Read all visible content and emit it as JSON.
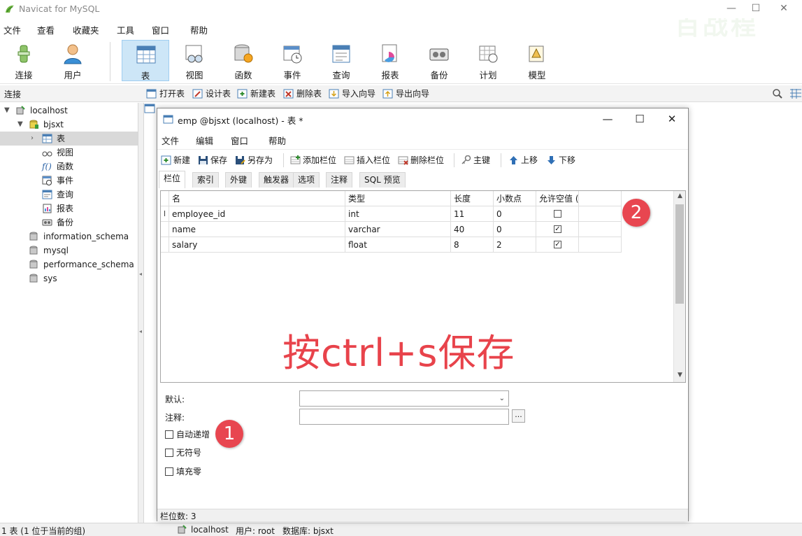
{
  "app": {
    "title": "Navicat for MySQL",
    "menu": [
      "文件",
      "查看",
      "收藏夹",
      "工具",
      "窗口",
      "帮助"
    ],
    "window_controls": {
      "minimize": "—",
      "maximize": "☐",
      "close": "✕"
    }
  },
  "toolbar": {
    "items": [
      {
        "label": "连接",
        "icon": "connect-icon"
      },
      {
        "label": "用户",
        "icon": "user-icon"
      },
      {
        "label": "表",
        "icon": "table-icon",
        "active": true
      },
      {
        "label": "视图",
        "icon": "view-icon"
      },
      {
        "label": "函数",
        "icon": "function-icon"
      },
      {
        "label": "事件",
        "icon": "event-icon"
      },
      {
        "label": "查询",
        "icon": "query-icon"
      },
      {
        "label": "报表",
        "icon": "report-icon"
      },
      {
        "label": "备份",
        "icon": "backup-icon"
      },
      {
        "label": "计划",
        "icon": "schedule-icon"
      },
      {
        "label": "模型",
        "icon": "model-icon"
      }
    ]
  },
  "subbar": {
    "connection_label": "连接",
    "actions": [
      "打开表",
      "设计表",
      "新建表",
      "删除表",
      "导入向导",
      "导出向导"
    ]
  },
  "tree": {
    "items": [
      {
        "label": "localhost",
        "icon": "server-icon",
        "expanded": true
      },
      {
        "label": "bjsxt",
        "icon": "database-icon",
        "expanded": true
      },
      {
        "label": "表",
        "icon": "table-icon",
        "selected": true
      },
      {
        "label": "视图",
        "icon": "view-icon"
      },
      {
        "label": "函数",
        "icon": "function-icon"
      },
      {
        "label": "事件",
        "icon": "event-icon"
      },
      {
        "label": "查询",
        "icon": "query-icon"
      },
      {
        "label": "报表",
        "icon": "report-icon"
      },
      {
        "label": "备份",
        "icon": "backup-icon"
      },
      {
        "label": "information_schema",
        "icon": "database-icon"
      },
      {
        "label": "mysql",
        "icon": "database-icon"
      },
      {
        "label": "performance_schema",
        "icon": "database-icon"
      },
      {
        "label": "sys",
        "icon": "database-icon"
      }
    ]
  },
  "status": {
    "left": "1 表 (1 位于当前的组)",
    "connection": "localhost",
    "user": "用户: root",
    "database": "数据库: bjsxt"
  },
  "designer": {
    "title": "emp @bjsxt (localhost) - 表 *",
    "menu": [
      "文件",
      "编辑",
      "窗口",
      "帮助"
    ],
    "tools": [
      "新建",
      "保存",
      "另存为",
      "添加栏位",
      "插入栏位",
      "删除栏位",
      "主键",
      "上移",
      "下移"
    ],
    "tabs": [
      "栏位",
      "索引",
      "外键",
      "触发器",
      "选项",
      "注释",
      "SQL 预览"
    ],
    "columns": [
      "名",
      "类型",
      "长度",
      "小数点",
      "允许空值 ("
    ],
    "rows": [
      {
        "name": "employee_id",
        "type": "int",
        "length": "11",
        "decimals": "0",
        "nullable": false,
        "cursor": "I"
      },
      {
        "name": "name",
        "type": "varchar",
        "length": "40",
        "decimals": "0",
        "nullable": true
      },
      {
        "name": "salary",
        "type": "float",
        "length": "8",
        "decimals": "2",
        "nullable": true
      }
    ],
    "overlay_text": "按ctrl+s保存",
    "badge_1": "1",
    "badge_2": "2",
    "props": {
      "default_label": "默认:",
      "comment_label": "注释:",
      "ellipsis": "...",
      "checkboxes": [
        "自动递增",
        "无符号",
        "填充零"
      ]
    },
    "footer": "栏位数: 3"
  },
  "colors": {
    "accent": "#cde6f7",
    "annotation_red": "#e8434b"
  }
}
